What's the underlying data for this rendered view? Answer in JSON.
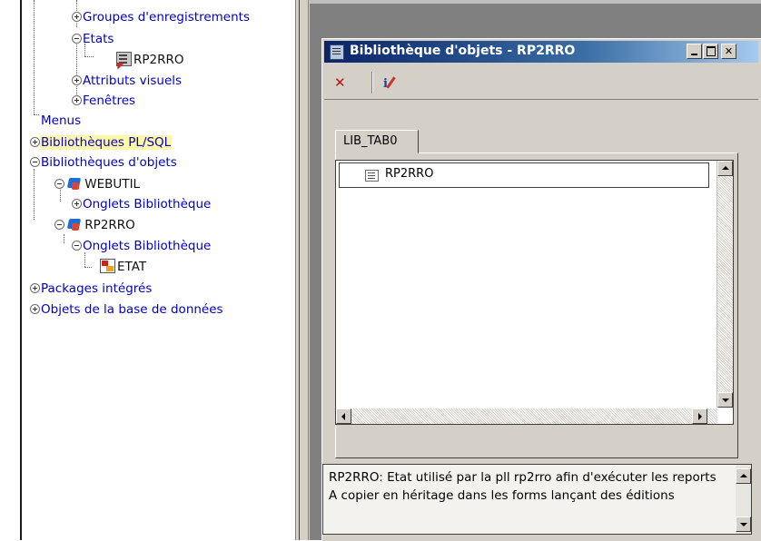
{
  "tree": {
    "items": [
      {
        "label": "Groupes d'enregistrements",
        "toggle": "plus"
      },
      {
        "label": "Etats",
        "toggle": "minus"
      },
      {
        "label": "RP2RRO",
        "icon": "report-icon"
      },
      {
        "label": "Attributs visuels",
        "toggle": "plus"
      },
      {
        "label": "Fenêtres",
        "toggle": "plus"
      },
      {
        "label": "Menus"
      },
      {
        "label": "Bibliothèques PL/SQL",
        "toggle": "plus",
        "highlighted": true
      },
      {
        "label": "Bibliothèques d'objets",
        "toggle": "minus"
      },
      {
        "label": "WEBUTIL",
        "toggle": "minus",
        "icon": "object-library-icon"
      },
      {
        "label": "Onglets Bibliothèque",
        "toggle": "plus"
      },
      {
        "label": "RP2RRO",
        "toggle": "minus",
        "icon": "object-library-icon"
      },
      {
        "label": "Onglets Bibliothèque",
        "toggle": "minus"
      },
      {
        "label": "ETAT",
        "icon": "library-tab-icon"
      },
      {
        "label": "Packages intégrés",
        "toggle": "plus"
      },
      {
        "label": "Objets de la base de données",
        "toggle": "plus"
      }
    ]
  },
  "window": {
    "title": "Bibliothèque d'objets - RP2RRO",
    "toolbar": {
      "delete_icon": "delete-icon",
      "properties_icon": "properties-icon"
    },
    "tab_label": "LIB_TAB0",
    "list_items": [
      {
        "label": "RP2RRO",
        "icon": "report-icon"
      }
    ],
    "description": "RP2RRO: Etat utilisé par la pll rp2rro afin d'exécuter les reports\nA copier en héritage dans les forms lançant des éditions"
  },
  "colors": {
    "link_text": "#0000c8",
    "highlight": "#fff7a8",
    "title_gradient_start": "#0a246a",
    "title_gradient_end": "#a6caf0",
    "mdi_background": "#808080",
    "window_face": "#d4d0c8"
  }
}
